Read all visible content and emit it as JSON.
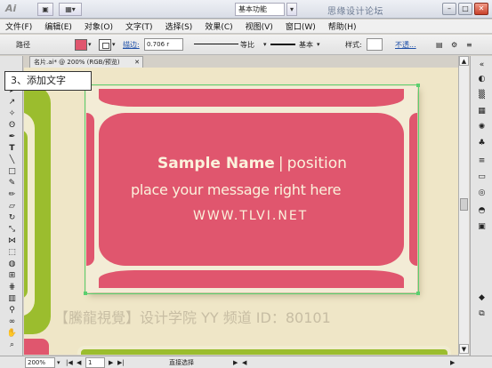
{
  "titlebar": {
    "app_logo": "Ai",
    "workspace": "基本功能",
    "watermark": "思缘设计论坛",
    "win_minimize": "–",
    "win_maximize": "□",
    "win_close": "✕"
  },
  "menu": {
    "items": [
      "文件(F)",
      "编辑(E)",
      "对象(O)",
      "文字(T)",
      "选择(S)",
      "效果(C)",
      "视图(V)",
      "窗口(W)",
      "帮助(H)"
    ]
  },
  "control": {
    "object_label": "路径",
    "stroke_label": "描边:",
    "stroke_value": "0.706 r",
    "profile_label": "等比",
    "brush_label": "基本",
    "style_label": "样式:",
    "opacity_label": "不透...",
    "fill_color": "#e0566e"
  },
  "document": {
    "tab_title": "名片.ai* @ 200% (RGB/预览)",
    "tab_close": "✕"
  },
  "callout": {
    "text": "3、添加文字"
  },
  "card": {
    "name": "Sample Name",
    "separator": "|",
    "position": "position",
    "message": "place your message right here",
    "url": "WWW.TLVI.NET",
    "pink_color": "#e0566e",
    "cream_color": "#f3ecd6",
    "green_color": "#9bbd2e"
  },
  "watermark_bottom": "【騰龍視覺】设计学院 YY 频道 ID：80101",
  "status": {
    "zoom": "200%",
    "page": "1",
    "tool": "直接选择"
  }
}
